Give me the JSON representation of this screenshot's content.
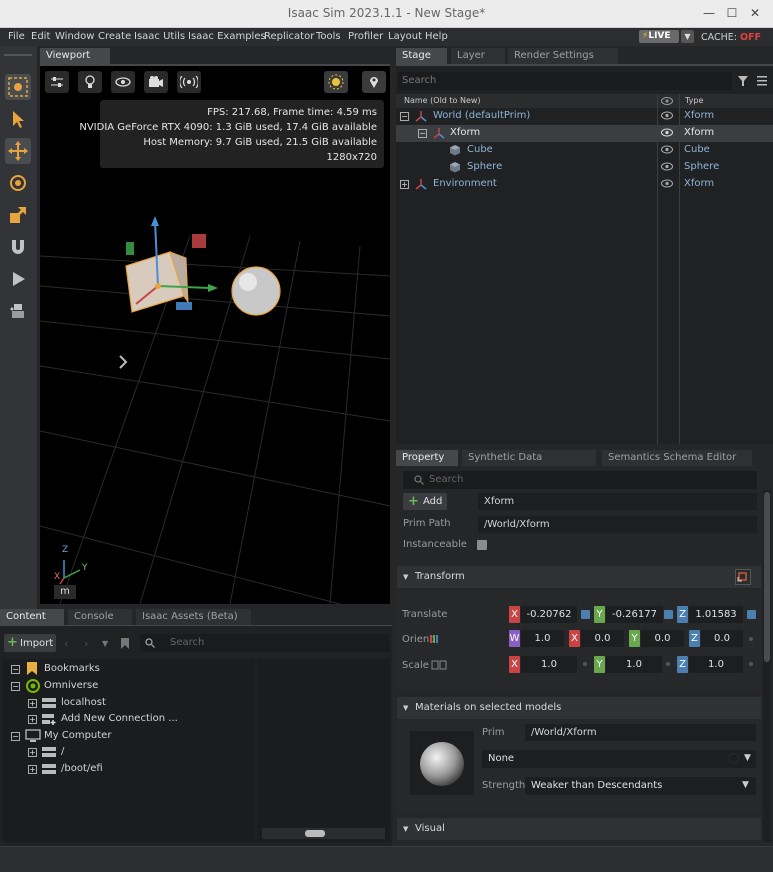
{
  "window": {
    "title": "Isaac Sim 2023.1.1 - New Stage*",
    "minimize": "—",
    "maximize": "☐",
    "close": "✕"
  },
  "menu": [
    "File",
    "Edit",
    "Window",
    "Create",
    "Isaac Utils",
    "Isaac Examples",
    "Replicator",
    "Tools",
    "Profiler",
    "Layout",
    "Help"
  ],
  "live": {
    "label": "LIVE",
    "cache_label": "CACHE:",
    "cache_state": "OFF"
  },
  "viewport": {
    "tab": "Viewport",
    "stats": {
      "fps": "FPS: 217.68, Frame time: 4.59 ms",
      "gpu": "NVIDIA GeForce RTX 4090: 1.3 GiB used, 17.4 GiB available",
      "host": "Host Memory: 9.7 GiB used, 21.5 GiB available",
      "res": "1280x720"
    },
    "axis_labels": {
      "z": "Z",
      "y": "Y",
      "x": "X"
    },
    "units": "m"
  },
  "stage": {
    "tabs": [
      "Stage",
      "Layer",
      "Render Settings"
    ],
    "search_placeholder": "Search",
    "col_name": "Name (Old to New)",
    "col_type": "Type",
    "rows": [
      {
        "name": "World (defaultPrim)",
        "type": "Xform"
      },
      {
        "name": "Xform",
        "type": "Xform"
      },
      {
        "name": "Cube",
        "type": "Cube"
      },
      {
        "name": "Sphere",
        "type": "Sphere"
      },
      {
        "name": "Environment",
        "type": "Xform"
      }
    ]
  },
  "property": {
    "tabs": [
      "Property",
      "Synthetic Data Recorder",
      "Semantics Schema Editor"
    ],
    "search_placeholder": "Search",
    "add_label": "Add",
    "name_value": "Xform",
    "prim_path_label": "Prim Path",
    "prim_path": "/World/Xform",
    "instanceable_label": "Instanceable",
    "transform": {
      "title": "Transform",
      "translate_label": "Translate",
      "translate": {
        "x": "-0.20762",
        "y": "-0.26177",
        "z": "1.01583"
      },
      "orient_label": "Orient",
      "orient": {
        "w": "1.0",
        "x": "0.0",
        "y": "0.0",
        "z": "0.0"
      },
      "scale_label": "Scale",
      "scale": {
        "x": "1.0",
        "y": "1.0",
        "z": "1.0"
      }
    },
    "materials": {
      "title": "Materials on selected models",
      "prim_label": "Prim",
      "prim_value": "/World/Xform",
      "material_value": "None",
      "strength_label": "Strength",
      "strength_value": "Weaker than Descendants"
    },
    "visual_title": "Visual"
  },
  "content": {
    "tabs": [
      "Content",
      "Console",
      "Isaac Assets (Beta)"
    ],
    "import_label": "Import",
    "search_placeholder": "Search",
    "tree": [
      {
        "label": "Bookmarks"
      },
      {
        "label": "Omniverse"
      },
      {
        "label": "localhost"
      },
      {
        "label": "Add New Connection ..."
      },
      {
        "label": "My Computer"
      },
      {
        "label": "/"
      },
      {
        "label": "/boot/efi"
      }
    ]
  },
  "colors": {
    "accent": "#e8a33c",
    "selection": "#3b3e41",
    "link": "#8eb4d8",
    "cache_off": "#e04040"
  }
}
